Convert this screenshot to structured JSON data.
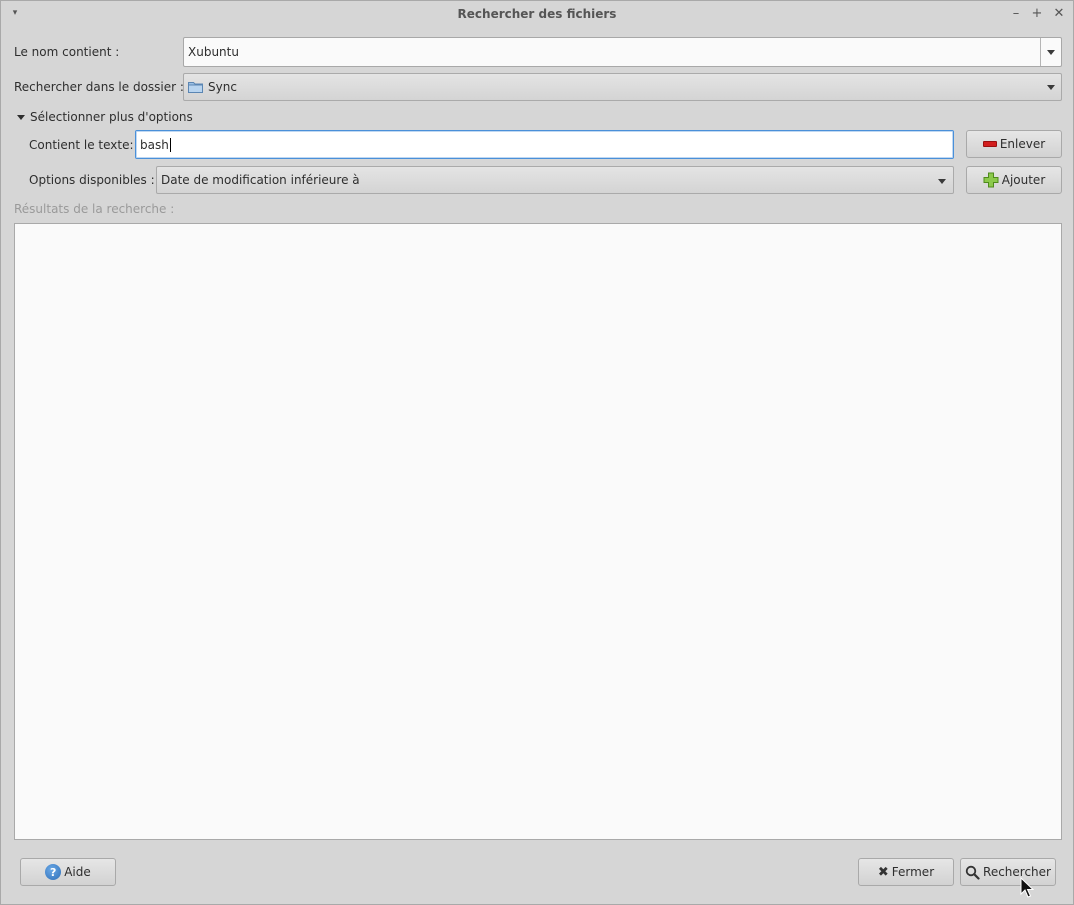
{
  "window": {
    "title": "Rechercher des fichiers",
    "menu_glyph": "▾",
    "minimize_glyph": "–",
    "maximize_glyph": "+",
    "close_glyph": "✕"
  },
  "name_filter": {
    "label": "Le nom contient :",
    "value": "Xubuntu"
  },
  "folder": {
    "label": "Rechercher dans le dossier :",
    "value": "Sync",
    "icon": "folder-icon"
  },
  "options": {
    "expander_label": "Sélectionner plus d'options",
    "contains_text_label": "Contient le texte:",
    "contains_text_value": "bash",
    "remove_button": "Enlever",
    "available_label": "Options disponibles :",
    "available_selected": "Date de modification inférieure à",
    "add_button": "Ajouter"
  },
  "results": {
    "label": "Résultats de la recherche :"
  },
  "footer": {
    "help_button": "Aide",
    "close_button": "Fermer",
    "search_button": "Rechercher"
  },
  "colors": {
    "window_bg": "#d6d6d6",
    "focus_border": "#4a90d9",
    "remove_red": "#d21e1e",
    "add_green": "#6ab42a"
  }
}
